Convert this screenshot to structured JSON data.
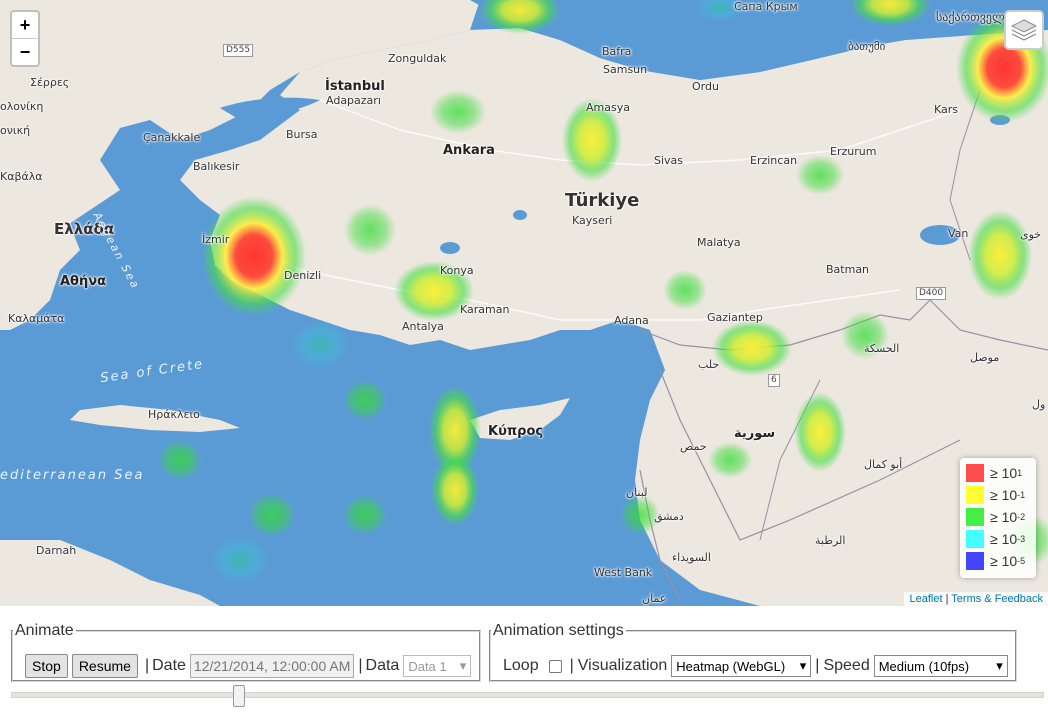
{
  "map": {
    "zoom_in": "+",
    "zoom_out": "−",
    "layers_icon": "layers-icon",
    "colors": {
      "water": "#5b9bd5",
      "land": "#ece7df"
    },
    "labels": {
      "ellada": "Ελλάδα",
      "athina": "Αθήνα",
      "kalamata": "Καλαμάτα",
      "irakleio": "Ηράκλειο",
      "serres": "Σέρρες",
      "alexandroupoli": "ολονίκη",
      "mytilene": "ονική",
      "kavala": "Καβάλα",
      "turkiye": "Türkiye",
      "istanbul": "İstanbul",
      "adapazari": "Adapazarı",
      "zonguldak": "Zonguldak",
      "bafra": "Bafra",
      "samsun": "Samsun",
      "ordu": "Ordu",
      "amasya": "Amasya",
      "sivas": "Sivas",
      "erzincan": "Erzincan",
      "erzurum": "Erzurum",
      "kars": "Kars",
      "ankara": "Ankara",
      "kayseri": "Kayseri",
      "malatya": "Malatya",
      "batman": "Batman",
      "van": "Van",
      "canakkale": "Çanakkale",
      "bursa": "Bursa",
      "balikesir": "Balıkesir",
      "izmir": "İzmir",
      "denizli": "Denizli",
      "konya": "Konya",
      "karaman": "Karaman",
      "antalya": "Antalya",
      "adana": "Adana",
      "gaziantep": "Gaziantep",
      "halab": "حلب",
      "kibris": "Κύπρος",
      "suriye": "سورية",
      "hasakah": "الحسكة",
      "mosul": "موصل",
      "homs": "حمص",
      "abu_kamal": "أبو كمال",
      "rutba": "الرطبة",
      "dimashq": "دمشق",
      "lubnan": "لبنان",
      "suwayda": "السويداء",
      "amman": "عمان",
      "west_bank": "West Bank",
      "darnah": "Darnah",
      "sakartvelo": "საქართველ",
      "batumi": "ბათუმი",
      "khoy": "خوی",
      "arbil": "ول",
      "trabzon_s": "Сапа Крым",
      "sea_crete": "Sea of Crete",
      "aegean": "Aegean Sea",
      "mediterranean": "editerranean Sea",
      "road_d555": "D555",
      "road_d400": "D400",
      "road_6": "6"
    },
    "legend": [
      {
        "color": "#ff4d4d",
        "base": "≥ 10",
        "exp": "1"
      },
      {
        "color": "#ffff33",
        "base": "≥ 10",
        "exp": "-1"
      },
      {
        "color": "#44ee44",
        "base": "≥ 10",
        "exp": "-2"
      },
      {
        "color": "#44ffff",
        "base": "≥ 10",
        "exp": "-3"
      },
      {
        "color": "#4444ff",
        "base": "≥ 10",
        "exp": "-5"
      }
    ],
    "attribution": {
      "leaflet": "Leaflet",
      "sep": " | ",
      "terms": "Terms & Feedback"
    }
  },
  "animate": {
    "legend": "Animate",
    "stop_label": "Stop",
    "resume_label": "Resume",
    "sep": "|",
    "date_label": "Date",
    "date_value": "12/21/2014, 12:00:00 AM",
    "data_label": "Data",
    "data_value": "Data 1"
  },
  "settings": {
    "legend": "Animation settings",
    "loop_label": "Loop",
    "loop_checked": false,
    "sep": "|",
    "viz_label": "Visualization",
    "viz_value": "Heatmap (WebGL)",
    "speed_label": "Speed",
    "speed_value": "Medium (10fps)"
  },
  "timeline": {
    "position_fraction": 0.22
  }
}
